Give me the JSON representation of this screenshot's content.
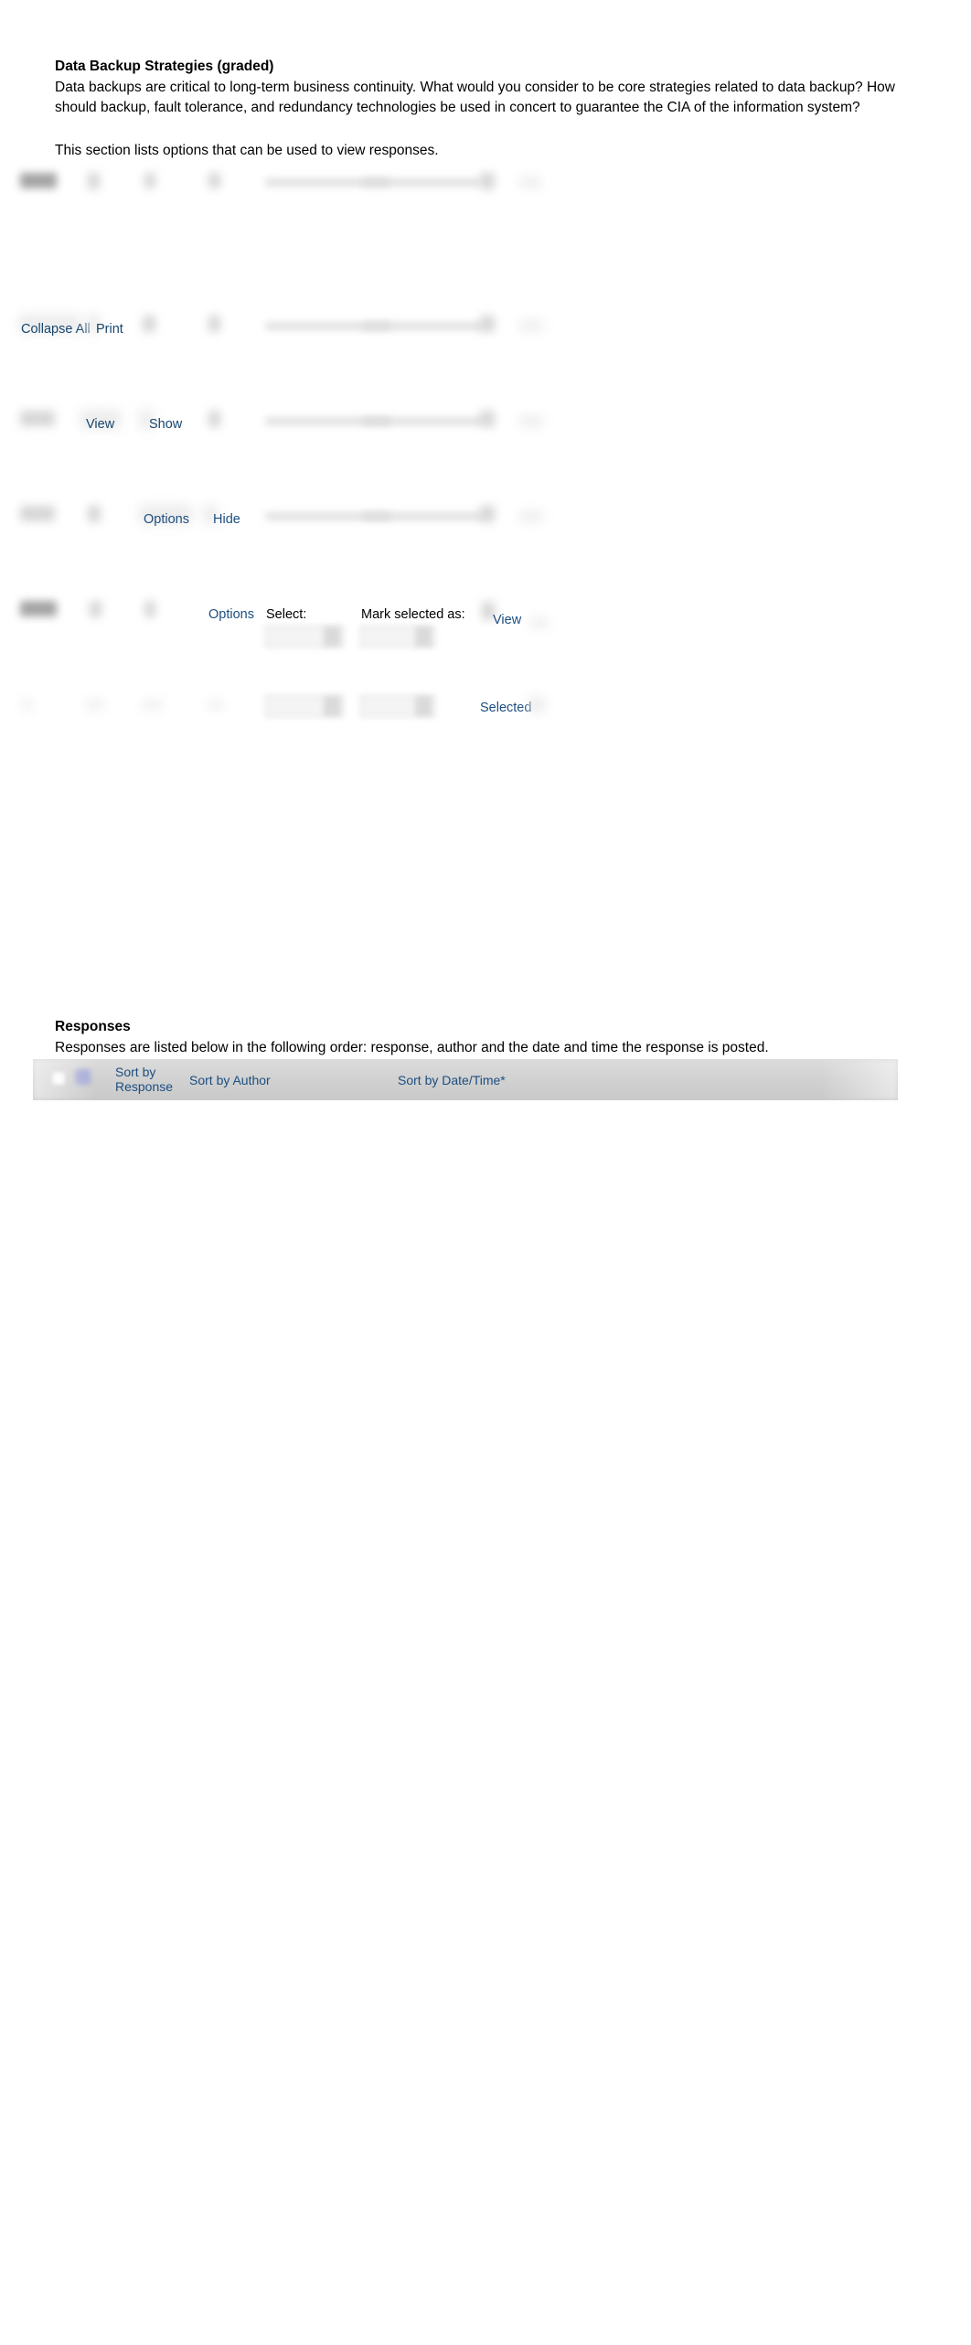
{
  "intro": {
    "title": "Data Backup Strategies (graded)",
    "body": "Data backups are critical to long-term business continuity. What would you consider to be core strategies related to data backup? How should backup, fault tolerance, and redundancy technologies be used in concert to guarantee the CIA of the information system?",
    "note": "This section lists options that can be used to view responses."
  },
  "toolbar": {
    "collapse_all": "Collapse All",
    "print": "Print",
    "view": "View",
    "show": "Show",
    "options": "Options",
    "hide": "Hide",
    "options_2": "Options",
    "select_label": "Select:",
    "mark_selected_as_label": "Mark selected as:",
    "view_2": "View",
    "selected": "Selected"
  },
  "responses": {
    "title": "Responses",
    "description": "Responses are listed below in the following order: response, author and the date and time the response is posted."
  },
  "sortbar": {
    "sort_by_response": "Sort by\nResponse",
    "sort_by_author": "Sort by Author",
    "sort_by_datetime": "Sort by Date/Time*"
  },
  "colors": {
    "link": "#1c4e80",
    "link_navy": "#17466e",
    "text": "#000000",
    "sortbar_bg": "#d2d2d2",
    "page_bg": "#ffffff"
  }
}
